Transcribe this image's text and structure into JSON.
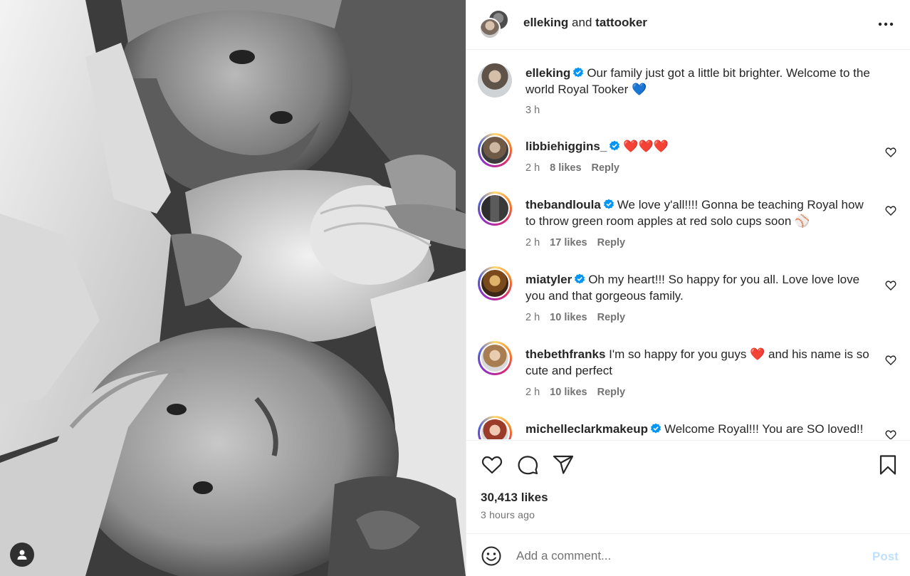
{
  "header": {
    "user1": "elleking",
    "joiner": "and",
    "user2": "tattooker",
    "more_icon": "more-horizontal-icon"
  },
  "caption": {
    "username": "elleking",
    "text": "Our family just got a little bit brighter. Welcome to the world Royal Tooker",
    "emoji": "💙",
    "time": "3 h"
  },
  "comments": [
    {
      "username": "libbiehiggins_",
      "verified": true,
      "text": "",
      "emoji": "❤️❤️❤️",
      "time": "2 h",
      "likes": "8 likes",
      "reply": "Reply"
    },
    {
      "username": "thebandloula",
      "verified": true,
      "text": "We love y'all!!!! Gonna be teaching Royal how to throw green room apples at red solo cups soon",
      "emoji": "⚾",
      "time": "2 h",
      "likes": "17 likes",
      "reply": "Reply"
    },
    {
      "username": "miatyler",
      "verified": true,
      "text": "Oh my heart!!! So happy for you all. Love love love you and that gorgeous family.",
      "emoji": "",
      "time": "2 h",
      "likes": "10 likes",
      "reply": "Reply"
    },
    {
      "username": "thebethfranks",
      "verified": false,
      "text_before": "I'm so happy for you guys",
      "emoji": "❤️",
      "text_after": "and his name is so cute and perfect",
      "time": "2 h",
      "likes": "10 likes",
      "reply": "Reply"
    },
    {
      "username": "michelleclarkmakeup",
      "verified": true,
      "text": "Welcome Royal!!! You are SO loved!!",
      "emoji": "",
      "time": "",
      "likes": "",
      "reply": ""
    }
  ],
  "actions": {
    "like_icon": "heart-icon",
    "comment_icon": "comment-bubble-icon",
    "share_icon": "send-paper-plane-icon",
    "save_icon": "bookmark-icon"
  },
  "likes_count": "30,413 likes",
  "posted_ago": "3 hours ago",
  "add_comment": {
    "placeholder": "Add a comment...",
    "post_label": "Post",
    "emoji_icon": "smiley-face-icon"
  },
  "colors": {
    "verified_blue": "#0095f6",
    "post_disabled": "#c0dffd",
    "meta_gray": "#737373",
    "text_dark": "#262626"
  }
}
